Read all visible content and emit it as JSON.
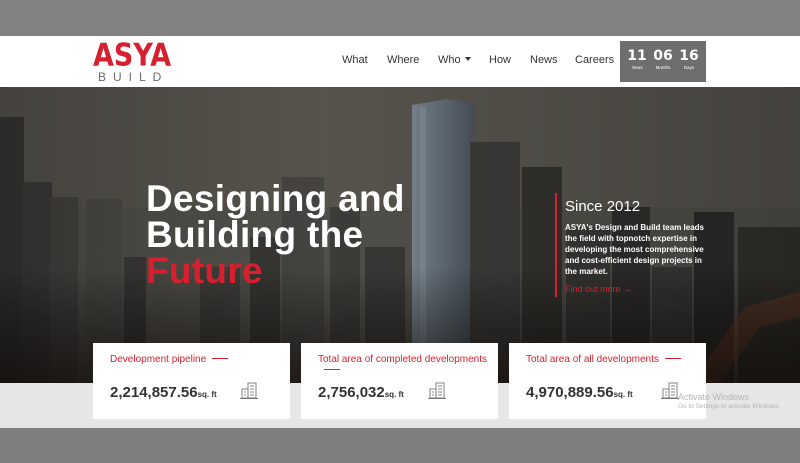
{
  "brand": {
    "logo_top": "ASYA",
    "logo_bottom": "BUILD",
    "accent": "#d6202f"
  },
  "nav": {
    "items": [
      {
        "label": "What"
      },
      {
        "label": "Where"
      },
      {
        "label": "Who"
      },
      {
        "label": "How"
      },
      {
        "label": "News"
      },
      {
        "label": "Careers"
      }
    ]
  },
  "countdown": {
    "years": "11",
    "years_label": "Years",
    "months": "06",
    "months_label": "Months",
    "days": "16",
    "days_label": "Days"
  },
  "hero": {
    "line1": "Designing and",
    "line2": "Building the",
    "line3": "Future",
    "since_title": "Since 2012",
    "since_text": "ASYA's Design and Build team leads the field with topnotch expertise in developing the most comprehensive and cost-efficient design projects in the market.",
    "find_out_more": "Find out more →"
  },
  "stats": [
    {
      "label": "Development pipeline",
      "value": "2,214,857.56",
      "unit": "sq. ft",
      "icon": "building-icon"
    },
    {
      "label": "Total area of completed developments",
      "value": "2,756,032",
      "unit": "sq. ft",
      "icon": "building-icon"
    },
    {
      "label": "Total area of all developments",
      "value": "4,970,889.56",
      "unit": "sq. ft",
      "icon": "building-icon"
    }
  ],
  "watermark": {
    "line1": "Activate Windows",
    "line2": "Go to Settings to activate Windows."
  }
}
